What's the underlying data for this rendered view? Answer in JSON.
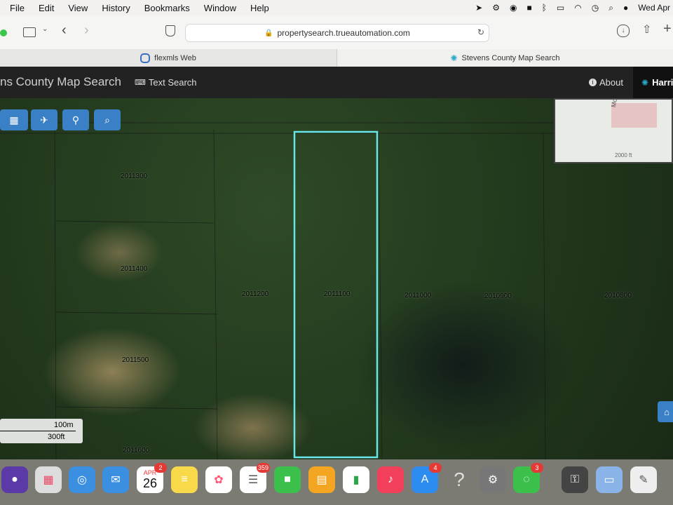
{
  "menubar": {
    "items": [
      "File",
      "Edit",
      "View",
      "History",
      "Bookmarks",
      "Window",
      "Help"
    ],
    "clock": "Wed Apr"
  },
  "browser": {
    "url": "propertysearch.trueautomation.com",
    "tabs": [
      {
        "label": "flexmls Web"
      },
      {
        "label": "Stevens County Map Search"
      }
    ]
  },
  "app": {
    "title": "ns County Map Search",
    "text_search": "Text Search",
    "about": "About",
    "user": "Harri"
  },
  "map": {
    "minimap_labels": [
      "Moore Rd",
      "2000 ft"
    ],
    "parcels": [
      "2011300",
      "2011400",
      "2011200",
      "2011100",
      "2011000",
      "2010900",
      "2010800",
      "2011500",
      "2011600"
    ],
    "scale": {
      "m": "100m",
      "ft": "300ft"
    }
  },
  "dock": {
    "calendar": {
      "month": "APR",
      "day": "26",
      "badge": "2"
    },
    "reminders_badge": "359",
    "appstore_badge": "4",
    "messages_badge": "3"
  }
}
